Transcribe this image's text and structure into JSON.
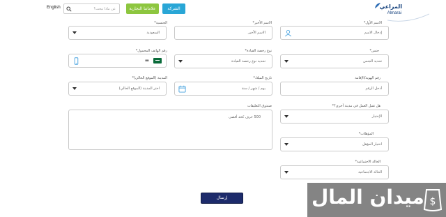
{
  "header": {
    "lang_label": "English",
    "search_placeholder": "عن ماذا تبحث؟",
    "btn_brands": "علاماتنا التجارية",
    "btn_company": "الشركة",
    "logo_ar": "المراعي",
    "logo_en": "Almarai"
  },
  "colors": {
    "green": "#8dc63f",
    "blue": "#29a6d6",
    "navy": "#1d2b6b"
  },
  "form": {
    "first_name": {
      "label": "الاسم الأول*",
      "placeholder": "إدخال الاسم"
    },
    "last_name": {
      "label": "الاسم الأخير*",
      "placeholder": "الاسم الأخير"
    },
    "nationality": {
      "label": "الجنسية*",
      "value": "السعودية"
    },
    "gender": {
      "label": "جنس*",
      "value": "تحديد الجنس"
    },
    "license": {
      "label": "نوع رخصة القيادة*",
      "value": "تحديد نوع رخصة القيادة"
    },
    "mobile": {
      "label": "رقم الهاتف المحمول*",
      "dial_indicator": "▪▪"
    },
    "id_number": {
      "label": "رقم الهوية/الإقامة",
      "placeholder": "أدخل الرقم"
    },
    "birth_date": {
      "label": "تاريخ الميلاد*",
      "placeholder": "يوم / شهر / سنة"
    },
    "city": {
      "label": "المدينة (الموقع الحالي)*",
      "value": "اختر المدينة (الموقع الحالي)"
    },
    "other_city": {
      "label": "هل تقبل العمل في مدينة أخرى؟*",
      "value": "الإختيار"
    },
    "comments": {
      "label": "صندوق التعليقات",
      "placeholder": "500 حرف كحد أقصى"
    },
    "qualifications": {
      "label": "المؤهلات*",
      "value": "اختيار المؤهل"
    },
    "marital": {
      "label": "الحالة الاجتماعية*",
      "value": "الحالة الاجتماعية"
    },
    "submit_label": "إرسال"
  },
  "watermark": {
    "text": "ميدان المال",
    "icon": "money-bag-icon"
  }
}
